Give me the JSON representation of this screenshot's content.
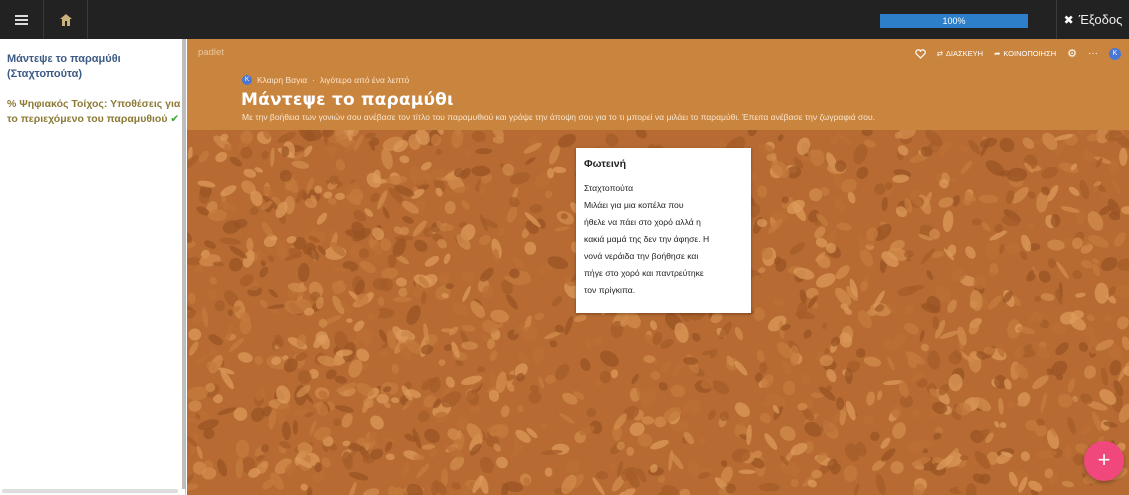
{
  "topbar": {
    "menu_icon": "hamburger-icon",
    "home_icon": "home-icon",
    "progress_label": "100%",
    "progress_fraction": 1.0,
    "exit_label": "Έξοδος",
    "exit_icon": "close-icon"
  },
  "sidebar": {
    "title": "Μάντεψε το παραμύθι (Σταχτοπούτα)",
    "items": [
      {
        "label": "Ψηφιακός Τοίχος: Υποθέσεις για το περιεχόμενο του παραμυθιού",
        "icon": "link-icon",
        "status_icon": "check-icon"
      }
    ]
  },
  "padlet": {
    "brand": "padlet",
    "actions": {
      "like_icon": "heart-icon",
      "remake_label": "ΔΙΑΣΚΕΥΗ",
      "share_label": "ΚΟΙΝΟΠΟΙΗΣΗ",
      "settings_icon": "gear-icon",
      "more_icon": "ellipsis-icon",
      "avatar_initial": "K"
    },
    "author_initial": "K",
    "author": "Κλαιρη Βαγια",
    "separator": "·",
    "time_ago": "λιγότερο από ένα λεπτό",
    "title": "Μάντεψε το παραμύθι",
    "description": "Με την βοήθεια των γονιών σου ανέβασε τον τίτλο του παραμυθιού και γράψε την άποψη σου για το τι μπορεί να μιλάει το παραμύθι. Έπειτα ανέβασε την ζωγραφιά σου.",
    "accent_color": "#c9843e",
    "card": {
      "author": "Φωτεινή",
      "lines": [
        "Σταχτοπούτα",
        "Μιλάει για μια κοπέλα που",
        "ήθελε να πάει στο χορό αλλά η",
        "κακιά μαμά της δεν την άφησε. Η",
        "νονά νεράιδα την βοήθησε και",
        "πήγε στο χορό και παντρεύτηκε",
        "τον πρίγκιπα."
      ]
    },
    "fab_label": "+",
    "fab_color": "#f0477c"
  }
}
